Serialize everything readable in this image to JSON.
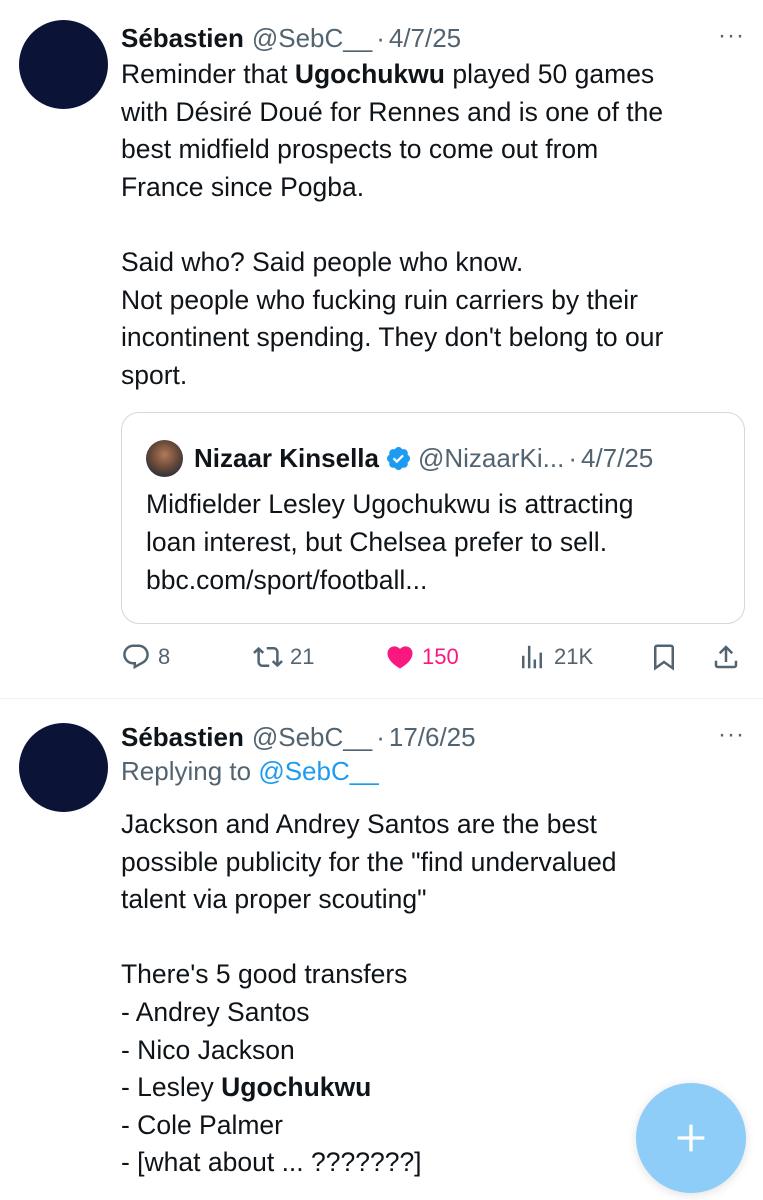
{
  "tweets": [
    {
      "author_name": "Sébastien",
      "author_handle": "@SebC__",
      "separator": "·",
      "date": "4/7/25",
      "more_icon": "···",
      "text_lines": [
        [
          "Reminder that ",
          "Ugochukwu",
          " played 50 games"
        ],
        "with Désiré Doué for Rennes and is one of the",
        "best midfield prospects to come out from",
        "France since Pogba.",
        "",
        "Said who? Said people who know.",
        "Not people who fucking ruin carriers by their",
        "incontinent spending. They don't belong to our",
        "sport."
      ],
      "quote": {
        "author_name": "Nizaar Kinsella",
        "author_handle": "@NizaarKi...",
        "separator": "·",
        "date": "4/7/25",
        "verified_color": "#1d9bf0",
        "text_lines": [
          "Midfielder Lesley Ugochukwu is attracting",
          "loan interest, but Chelsea prefer to sell.",
          "bbc.com/sport/football..."
        ]
      },
      "actions": {
        "replies": "8",
        "retweets": "21",
        "likes": "150",
        "views": "21K",
        "like_color": "#f91880"
      }
    },
    {
      "author_name": "Sébastien",
      "author_handle": "@SebC__",
      "separator": "·",
      "date": "17/6/25",
      "more_icon": "···",
      "replying_prefix": "Replying to ",
      "replying_to": "@SebC__",
      "text_lines": [
        "Jackson and Andrey Santos are the best",
        "possible publicity for the \"find undervalued",
        "talent via proper scouting\"",
        "",
        "There's 5 good transfers",
        "- Andrey Santos",
        "- Nico Jackson",
        [
          "- Lesley ",
          "Ugochukwu",
          ""
        ],
        "- Cole Palmer",
        "- [what about ... ???????]"
      ]
    }
  ],
  "fab": {
    "icon": "plus-icon",
    "color": "#8ecdf8"
  },
  "colors": {
    "accent": "#1d9bf0",
    "secondary_text": "#536471",
    "border": "#cfd9de"
  }
}
